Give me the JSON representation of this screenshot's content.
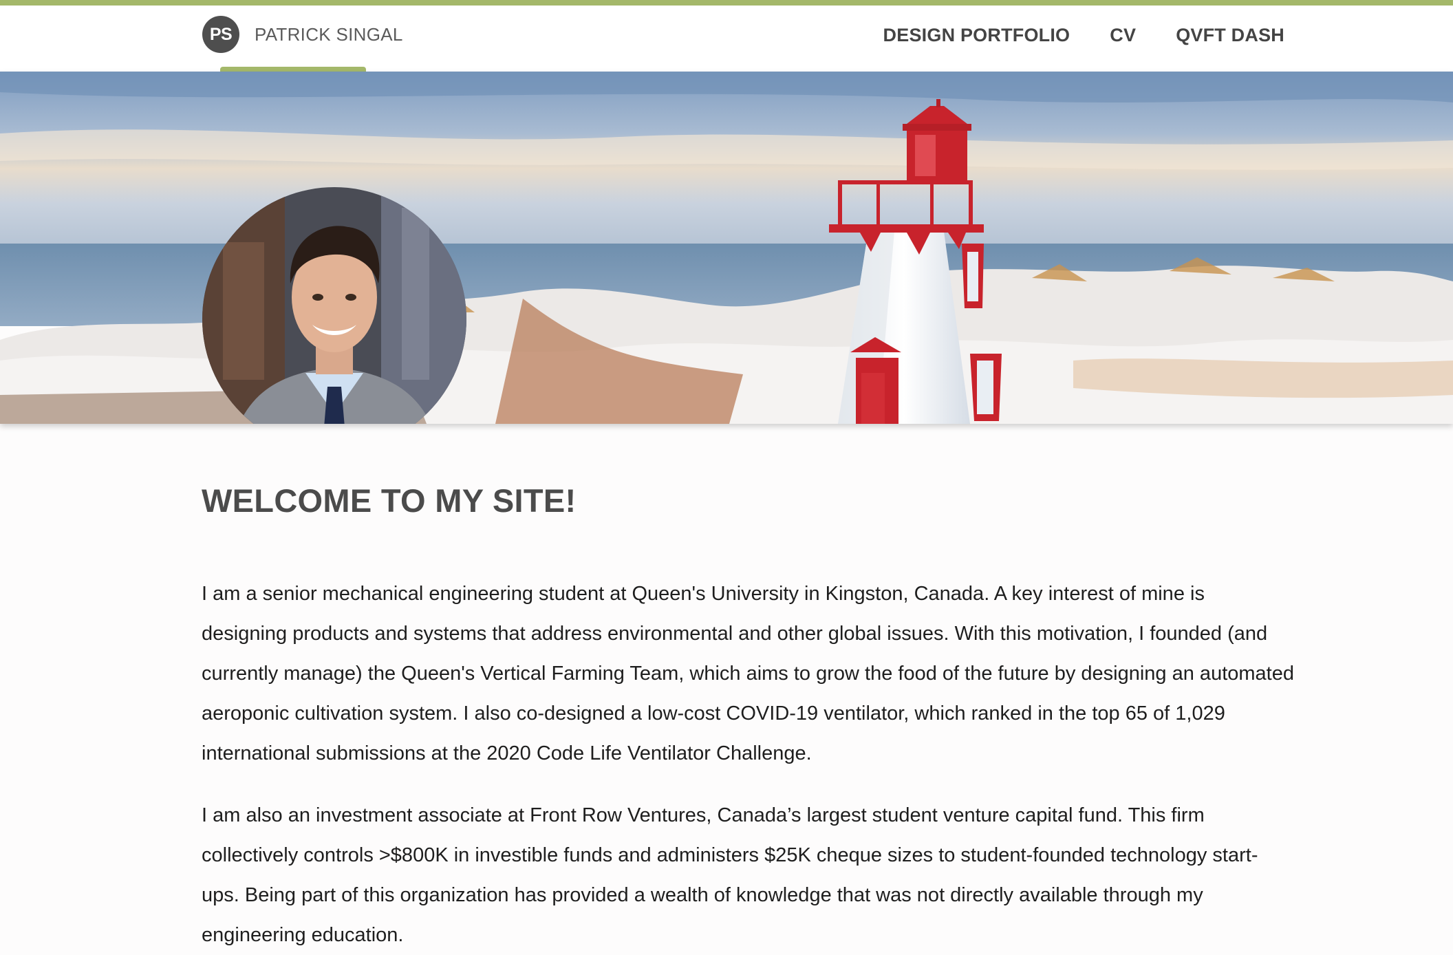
{
  "header": {
    "logo_initials": "PS",
    "site_name": "PATRICK SINGAL",
    "nav": [
      {
        "label": "DESIGN PORTFOLIO"
      },
      {
        "label": "CV"
      },
      {
        "label": "QVFT DASH"
      }
    ]
  },
  "main": {
    "heading": "WELCOME TO MY SITE!",
    "paragraphs": [
      "I am a senior mechanical engineering student at Queen's University in Kingston, Canada. A key interest of mine is designing products and systems that address environmental and other global issues. With this motivation, I founded (and currently manage) the Queen's Vertical Farming Team, which aims to grow the food of the future by designing an automated aeroponic cultivation system. I also co-designed a low-cost COVID-19 ventilator, which ranked in the top 65 of 1,029 international submissions at the 2020 Code Life Ventilator Challenge.",
      "I am also an investment associate at Front Row Ventures, Canada’s largest student venture capital fund. This firm collectively controls >$800K in investible funds and administers $25K cheque sizes to student-founded technology start-ups. Being part of this organization has provided a wealth of knowledge that was not directly available through my engineering education."
    ]
  },
  "colors": {
    "accent": "#a4b86a",
    "badge": "#4e4e4e",
    "nav_text": "#444444",
    "heading": "#4b4b4b",
    "lighthouse_red": "#c8232c"
  }
}
